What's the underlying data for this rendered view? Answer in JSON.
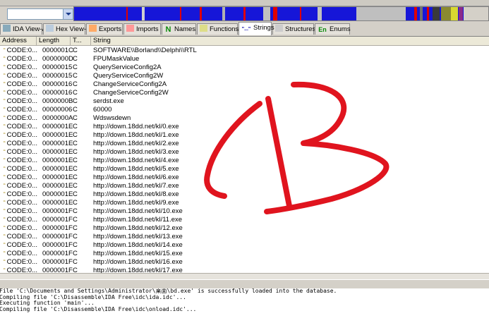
{
  "tabs": [
    {
      "label": "IDA View-A",
      "icon": "ida-view-icon"
    },
    {
      "label": "Hex View-A",
      "icon": "hex-view-icon"
    },
    {
      "label": "Exports",
      "icon": "exports-icon"
    },
    {
      "label": "Imports",
      "icon": "imports-icon"
    },
    {
      "label": "Names",
      "icon": "names-icon",
      "glyph": "N"
    },
    {
      "label": "Functions",
      "icon": "functions-icon"
    },
    {
      "label": "Strings",
      "icon": "strings-icon",
      "glyph": "\"...\""
    },
    {
      "label": "Structures",
      "icon": "structures-icon"
    },
    {
      "label": "Enums",
      "icon": "enums-icon",
      "glyph": "En"
    }
  ],
  "active_tab": "Strings",
  "columns": {
    "address": "Address",
    "length": "Length",
    "type": "T...",
    "string": "String"
  },
  "rows": [
    {
      "address": "CODE:0...",
      "length": "0000001C",
      "type": "C",
      "string": "SOFTWARE\\\\Borland\\\\Delphi\\\\RTL"
    },
    {
      "address": "CODE:0...",
      "length": "0000000D",
      "type": "C",
      "string": "FPUMaskValue"
    },
    {
      "address": "CODE:0...",
      "length": "00000015",
      "type": "C",
      "string": "QueryServiceConfig2A"
    },
    {
      "address": "CODE:0...",
      "length": "00000015",
      "type": "C",
      "string": "QueryServiceConfig2W"
    },
    {
      "address": "CODE:0...",
      "length": "00000016",
      "type": "C",
      "string": "ChangeServiceConfig2A"
    },
    {
      "address": "CODE:0...",
      "length": "00000016",
      "type": "C",
      "string": "ChangeServiceConfig2W"
    },
    {
      "address": "CODE:0...",
      "length": "0000000B",
      "type": "C",
      "string": "serdst.exe"
    },
    {
      "address": "CODE:0...",
      "length": "00000006",
      "type": "C",
      "string": "60000"
    },
    {
      "address": "CODE:0...",
      "length": "0000000A",
      "type": "C",
      "string": "Wdswsdewn"
    },
    {
      "address": "CODE:0...",
      "length": "0000001E",
      "type": "C",
      "string": "http://down.18dd.net/kl/0.exe"
    },
    {
      "address": "CODE:0...",
      "length": "0000001E",
      "type": "C",
      "string": "http://down.18dd.net/kl/1.exe"
    },
    {
      "address": "CODE:0...",
      "length": "0000001E",
      "type": "C",
      "string": "http://down.18dd.net/kl/2.exe"
    },
    {
      "address": "CODE:0...",
      "length": "0000001E",
      "type": "C",
      "string": "http://down.18dd.net/kl/3.exe"
    },
    {
      "address": "CODE:0...",
      "length": "0000001E",
      "type": "C",
      "string": "http://down.18dd.net/kl/4.exe"
    },
    {
      "address": "CODE:0...",
      "length": "0000001E",
      "type": "C",
      "string": "http://down.18dd.net/kl/5.exe"
    },
    {
      "address": "CODE:0...",
      "length": "0000001E",
      "type": "C",
      "string": "http://down.18dd.net/kl/6.exe"
    },
    {
      "address": "CODE:0...",
      "length": "0000001E",
      "type": "C",
      "string": "http://down.18dd.net/kl/7.exe"
    },
    {
      "address": "CODE:0...",
      "length": "0000001E",
      "type": "C",
      "string": "http://down.18dd.net/kl/8.exe"
    },
    {
      "address": "CODE:0...",
      "length": "0000001E",
      "type": "C",
      "string": "http://down.18dd.net/kl/9.exe"
    },
    {
      "address": "CODE:0...",
      "length": "0000001F",
      "type": "C",
      "string": "http://down.18dd.net/kl/10.exe"
    },
    {
      "address": "CODE:0...",
      "length": "0000001F",
      "type": "C",
      "string": "http://down.18dd.net/kl/11.exe"
    },
    {
      "address": "CODE:0...",
      "length": "0000001F",
      "type": "C",
      "string": "http://down.18dd.net/kl/12.exe"
    },
    {
      "address": "CODE:0...",
      "length": "0000001F",
      "type": "C",
      "string": "http://down.18dd.net/kl/13.exe"
    },
    {
      "address": "CODE:0...",
      "length": "0000001F",
      "type": "C",
      "string": "http://down.18dd.net/kl/14.exe"
    },
    {
      "address": "CODE:0...",
      "length": "0000001F",
      "type": "C",
      "string": "http://down.18dd.net/kl/15.exe"
    },
    {
      "address": "CODE:0...",
      "length": "0000001F",
      "type": "C",
      "string": "http://down.18dd.net/kl/16.exe"
    },
    {
      "address": "CODE:0...",
      "length": "0000001F",
      "type": "C",
      "string": "http://down.18dd.net/kl/17.exe"
    }
  ],
  "output_lines": [
    "File 'C:\\Documents and Settings\\Administrator\\桌面\\bd.exe' is successfully loaded into the database.",
    "Compiling file 'C:\\Disassemble\\IDA Free\\idc\\ida.idc'...",
    "Executing function 'main'...",
    "Compiling file 'C:\\Disassemble\\IDA Free\\idc\\onload.idc'..."
  ],
  "colors": {
    "navband_base": "#1616d8",
    "annotation": "#e0141e",
    "window_bg": "#d4d0c8",
    "active_tab_bg": "#ffffff"
  }
}
